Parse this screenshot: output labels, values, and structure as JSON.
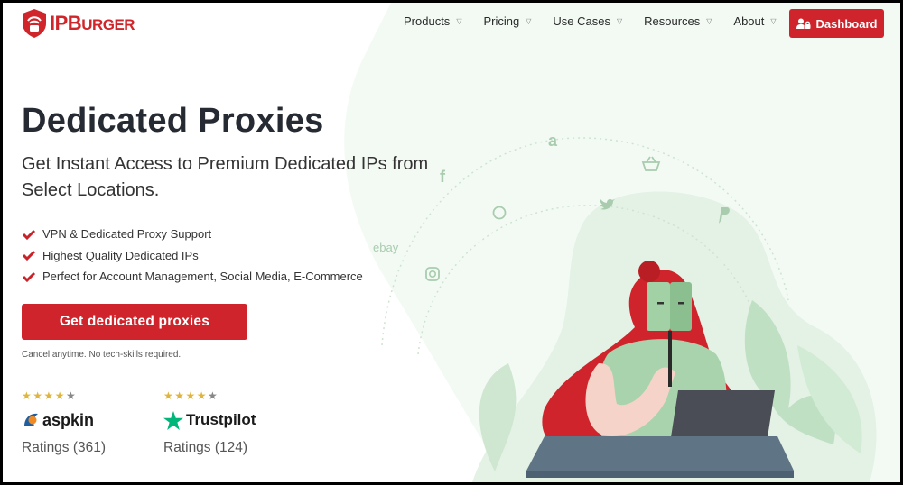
{
  "brand": {
    "name_prefix": "IP",
    "name_main": "B",
    "name_rest": "URGER",
    "color": "#d0262b"
  },
  "nav": {
    "items": [
      {
        "label": "Products",
        "icon": "chevron-down-icon"
      },
      {
        "label": "Pricing",
        "icon": "chevron-down-icon"
      },
      {
        "label": "Use Cases",
        "icon": "chevron-down-icon"
      },
      {
        "label": "Resources",
        "icon": "chevron-down-icon"
      },
      {
        "label": "About",
        "icon": "chevron-down-icon"
      }
    ],
    "chevron": "⌄",
    "dashboard_label": "Dashboard",
    "dashboard_icon": "user-lock-icon"
  },
  "hero": {
    "title": "Dedicated Proxies",
    "subtitle": "Get Instant Access to Premium Dedicated IPs from Select Locations.",
    "features": [
      "VPN & Dedicated Proxy Support",
      "Highest Quality Dedicated IPs",
      "Perfect for Account Management, Social Media, E-Commerce"
    ],
    "cta_label": "Get dedicated proxies",
    "note": "Cancel anytime. No tech-skills required."
  },
  "ratings": [
    {
      "source": "aspkin",
      "stars": 4.5,
      "stars_text": "★★★★",
      "half_star": "★",
      "count_label": "Ratings (361)"
    },
    {
      "source": "Trustpilot",
      "stars": 4.5,
      "stars_text": "★★★★",
      "half_star": "★",
      "count_label": "Ratings (124)"
    }
  ],
  "illustration": {
    "ecosystem_labels": [
      "ebay",
      "a",
      "f"
    ],
    "colors": {
      "accent": "#cf242b",
      "green_light": "#eef7ef",
      "green_mid": "#d9ecdb",
      "laptop": "#4a4d55",
      "desk": "#5f7585"
    }
  }
}
